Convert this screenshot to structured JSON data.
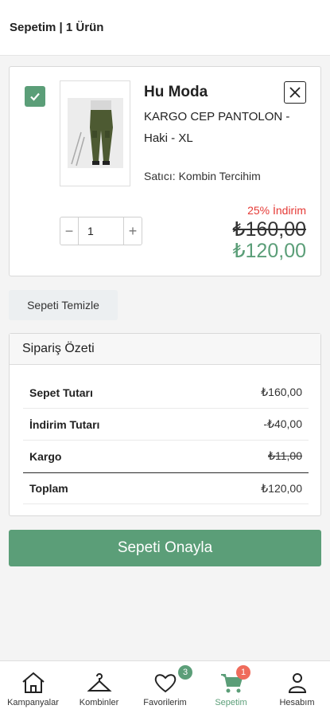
{
  "header": {
    "title": "Sepetim | 1 Ürün"
  },
  "cart_item": {
    "brand": "Hu Moda",
    "name": "KARGO CEP PANTOLON - Haki - XL",
    "seller": "Satıcı: Kombin Tercihim",
    "quantity": "1",
    "discount_label": "25% İndirim",
    "old_price": "₺160,00",
    "new_price": "₺120,00",
    "checkbox_checked": true,
    "check_color": "#5b9e78"
  },
  "actions": {
    "clear_label": "Sepeti Temizle",
    "confirm_label": "Sepeti Onayla"
  },
  "summary": {
    "title": "Sipariş Özeti",
    "rows": [
      {
        "label": "Sepet Tutarı",
        "value": "₺160,00"
      },
      {
        "label": "İndirim Tutarı",
        "value": "-₺40,00"
      },
      {
        "label": "Kargo",
        "value": "₺11,00"
      },
      {
        "label": "Toplam",
        "value": "₺120,00"
      }
    ]
  },
  "bottom_nav": {
    "items": [
      {
        "label": "Kampanyalar",
        "icon": "home-icon"
      },
      {
        "label": "Kombinler",
        "icon": "hanger-icon"
      },
      {
        "label": "Favorilerim",
        "icon": "heart-icon",
        "badge": "3"
      },
      {
        "label": "Sepetim",
        "icon": "cart-icon",
        "badge": "1",
        "active": true
      },
      {
        "label": "Hesabım",
        "icon": "user-icon"
      }
    ]
  },
  "colors": {
    "accent": "#5b9e78",
    "discount": "#e53935",
    "cart_badge": "#ef6b5b"
  }
}
